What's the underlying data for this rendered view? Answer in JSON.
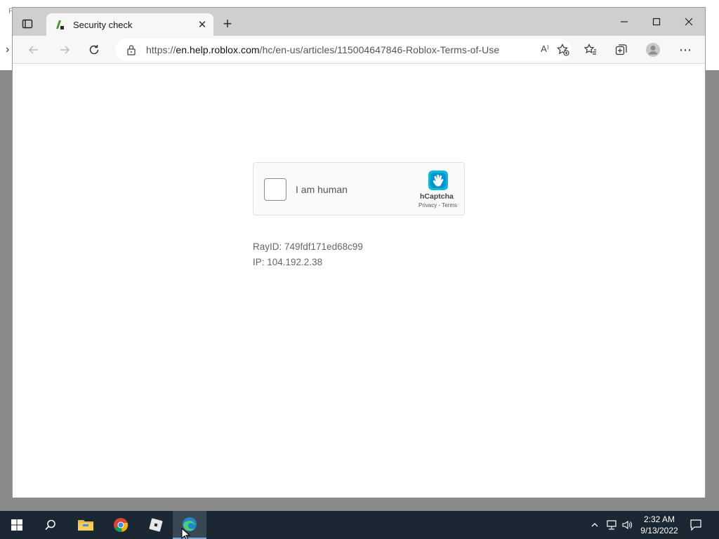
{
  "desktop": {
    "behind_text": "F"
  },
  "browser": {
    "tab": {
      "title": "Security check",
      "close_glyph": "✕"
    },
    "new_tab_glyph": "+",
    "window_controls": {
      "minimize": "—",
      "maximize": "☐",
      "close": "✕"
    },
    "address": {
      "scheme": "https://",
      "host": "en.help.roblox.com",
      "path": "/hc/en-us/articles/115004647846-Roblox-Terms-of-Use",
      "read_aloud": "A⁾"
    },
    "more_glyph": "⋯"
  },
  "page": {
    "captcha": {
      "checkbox_label": "I am human",
      "brand": "hCaptcha",
      "privacy": "Privacy",
      "separator": " - ",
      "terms": "Terms"
    },
    "ray_id": "RayID: 749fdf171ed68c99",
    "ip": "IP: 104.192.2.38"
  },
  "taskbar": {
    "items": [
      "start-icon",
      "search-icon",
      "file-explorer-icon",
      "chrome-icon",
      "roblox-icon",
      "edge-icon"
    ],
    "clock": {
      "time": "2:32 AM",
      "date": "9/13/2022"
    }
  },
  "colors": {
    "taskbar": "#1b2733",
    "titlebar": "#cfcfcf",
    "hcaptcha_blue": "#0074bf",
    "hcaptcha_teal": "#00bcd4"
  }
}
